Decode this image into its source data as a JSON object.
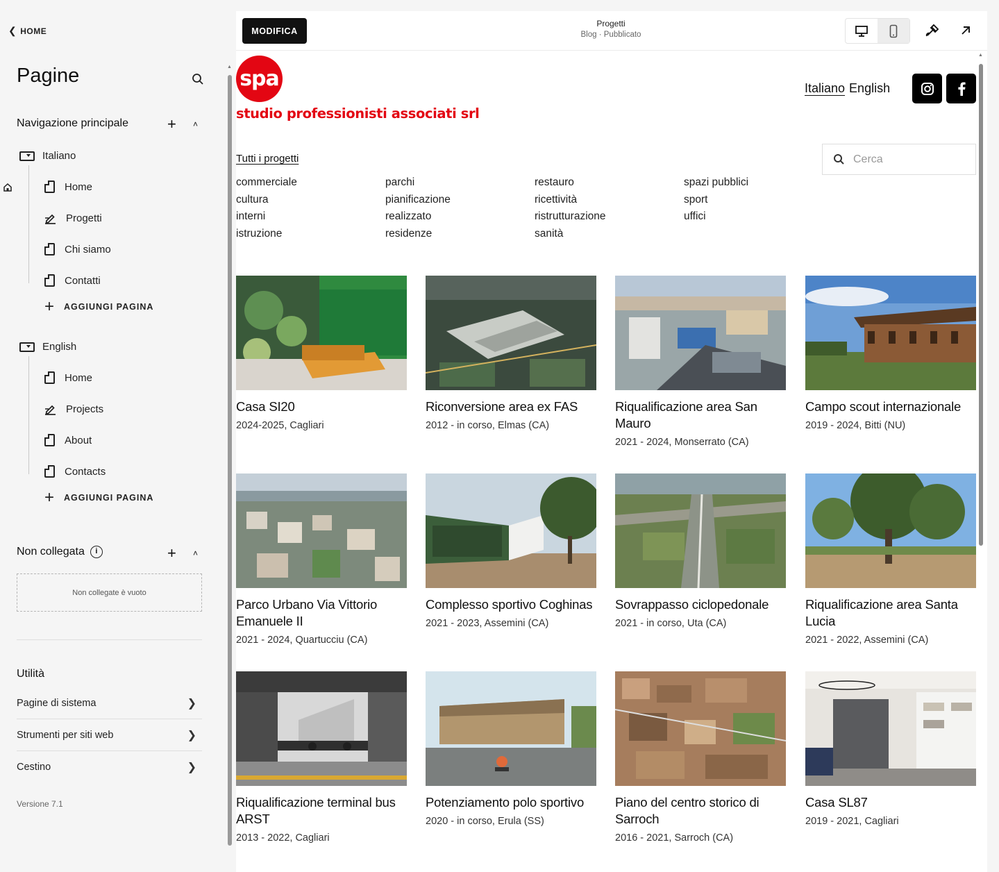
{
  "sidebar": {
    "back_label": "HOME",
    "title": "Pagine",
    "nav_section": "Navigazione principale",
    "italian": {
      "label": "Italiano",
      "pages": [
        "Home",
        "Progetti",
        "Chi siamo",
        "Contatti"
      ],
      "add": "AGGIUNGI PAGINA"
    },
    "english": {
      "label": "English",
      "pages": [
        "Home",
        "Projects",
        "About",
        "Contacts"
      ],
      "add": "AGGIUNGI PAGINA"
    },
    "unlinked": {
      "title": "Non collegata",
      "info": "i",
      "empty": "Non collegate è vuoto"
    },
    "utilities": {
      "title": "Utilità",
      "items": [
        "Pagine di sistema",
        "Strumenti per siti web",
        "Cestino"
      ]
    },
    "version": "Versione 7.1"
  },
  "preview": {
    "edit_button": "MODIFICA",
    "page_title": "Progetti",
    "page_sub": "Blog · Pubblicato"
  },
  "site": {
    "logo_mark": "spa",
    "logo_text": "studio professionisti associati srl",
    "lang_it": "Italiano",
    "lang_en": "English",
    "all_projects": "Tutti i progetti",
    "search_placeholder": "Cerca",
    "categories": [
      [
        "commerciale",
        "cultura",
        "interni",
        "istruzione"
      ],
      [
        "parchi",
        "pianificazione",
        "realizzato",
        "residenze"
      ],
      [
        "restauro",
        "ricettività",
        "ristrutturazione",
        "sanità"
      ],
      [
        "spazi pubblici",
        "sport",
        "uffici"
      ]
    ],
    "projects": [
      {
        "title": "Casa SI20",
        "meta": "2024-2025, Cagliari"
      },
      {
        "title": "Riconversione area ex FAS",
        "meta": "2012 - in corso, Elmas (CA)"
      },
      {
        "title": "Riqualificazione area San Mauro",
        "meta": "2021 - 2024, Monserrato (CA)"
      },
      {
        "title": "Campo scout internazionale",
        "meta": "2019 - 2024, Bitti (NU)"
      },
      {
        "title": "Parco Urbano Via Vittorio Emanuele II",
        "meta": "2021 - 2024, Quartucciu (CA)"
      },
      {
        "title": "Complesso sportivo Coghinas",
        "meta": "2021 - 2023, Assemini (CA)"
      },
      {
        "title": "Sovrappasso ciclopedonale",
        "meta": "2021 - in corso, Uta (CA)"
      },
      {
        "title": "Riqualificazione area Santa Lucia",
        "meta": "2021 - 2022, Assemini (CA)"
      },
      {
        "title": "Riqualificazione terminal bus ARST",
        "meta": "2013 - 2022, Cagliari"
      },
      {
        "title": "Potenziamento polo sportivo",
        "meta": "2020 - in corso, Erula (SS)"
      },
      {
        "title": "Piano del centro storico di Sarroch",
        "meta": "2016 - 2021, Sarroch (CA)"
      },
      {
        "title": "Casa SL87",
        "meta": "2019 - 2021, Cagliari"
      }
    ]
  },
  "colors": {
    "brand_red": "#e30613",
    "dark": "#111111",
    "sidebar_bg": "#f5f5f5"
  }
}
